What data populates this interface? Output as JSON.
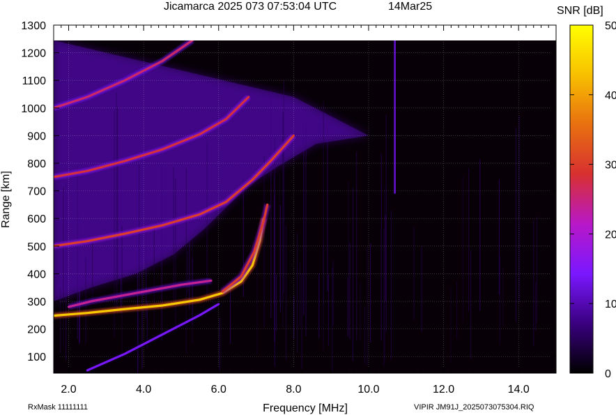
{
  "chart_data": {
    "type": "heatmap",
    "title": "Jicamarca 2025 073 07:53:04 UTC",
    "date_label": "14Mar25",
    "xlabel": "Frequency [MHz]",
    "ylabel": "Range [km]",
    "xlim": [
      1.6,
      15.0
    ],
    "ylim": [
      40,
      1300
    ],
    "data_range_top": 1245,
    "x_ticks": [
      "2.0",
      "4.0",
      "6.0",
      "8.0",
      "10.0",
      "12.0",
      "14.0"
    ],
    "x_tick_values": [
      2.0,
      4.0,
      6.0,
      8.0,
      10.0,
      12.0,
      14.0
    ],
    "y_ticks": [
      "100",
      "200",
      "300",
      "400",
      "500",
      "600",
      "700",
      "800",
      "900",
      "1000",
      "1100",
      "1200",
      "1300"
    ],
    "y_tick_values": [
      100,
      200,
      300,
      400,
      500,
      600,
      700,
      800,
      900,
      1000,
      1100,
      1200,
      1300
    ],
    "grid": true,
    "colorbar": {
      "label": "SNR [dB]",
      "range": [
        0,
        50
      ],
      "ticks": [
        "0",
        "10",
        "20",
        "30",
        "40",
        "50"
      ],
      "tick_values": [
        0,
        10,
        20,
        30,
        40,
        50
      ],
      "colors": [
        "#000000",
        "#3a0080",
        "#7a18ff",
        "#b818c8",
        "#d83030",
        "#e87010",
        "#f8c000",
        "#ffff00"
      ]
    },
    "background_snr": 1,
    "noise_cutoff": {
      "description_free": true,
      "points": [
        [
          1.6,
          1245
        ],
        [
          8.0,
          1040
        ],
        [
          10.0,
          900
        ],
        [
          8.6,
          870
        ],
        [
          7.6,
          790
        ],
        [
          6.8,
          720
        ],
        [
          6.2,
          640
        ],
        [
          5.6,
          560
        ],
        [
          4.8,
          470
        ],
        [
          3.8,
          400
        ],
        [
          2.6,
          350
        ],
        [
          1.6,
          300
        ]
      ]
    },
    "traces": [
      {
        "name": "",
        "snr": 44,
        "points": [
          [
            1.6,
            248
          ],
          [
            2.5,
            258
          ],
          [
            3.5,
            272
          ],
          [
            4.5,
            285
          ],
          [
            5.5,
            306
          ],
          [
            6.1,
            330
          ],
          [
            6.6,
            372
          ],
          [
            6.9,
            430
          ],
          [
            7.1,
            520
          ],
          [
            7.2,
            600
          ]
        ]
      },
      {
        "name": "",
        "snr": 30,
        "points": [
          [
            6.1,
            335
          ],
          [
            6.6,
            390
          ],
          [
            6.95,
            480
          ],
          [
            7.2,
            590
          ],
          [
            7.3,
            650
          ]
        ]
      },
      {
        "name": "",
        "snr": 30,
        "points": [
          [
            1.6,
            500
          ],
          [
            2.5,
            518
          ],
          [
            3.5,
            545
          ],
          [
            4.5,
            575
          ],
          [
            5.5,
            615
          ],
          [
            6.2,
            660
          ],
          [
            6.9,
            740
          ],
          [
            7.4,
            810
          ],
          [
            8.0,
            900
          ]
        ]
      },
      {
        "name": "",
        "snr": 28,
        "points": [
          [
            1.6,
            750
          ],
          [
            2.5,
            772
          ],
          [
            3.5,
            808
          ],
          [
            4.5,
            850
          ],
          [
            5.5,
            905
          ],
          [
            6.2,
            960
          ],
          [
            6.8,
            1040
          ]
        ]
      },
      {
        "name": "",
        "snr": 26,
        "points": [
          [
            1.6,
            1000
          ],
          [
            2.5,
            1040
          ],
          [
            3.5,
            1100
          ],
          [
            4.5,
            1170
          ],
          [
            5.3,
            1245
          ]
        ]
      },
      {
        "name": "",
        "snr": 24,
        "points": [
          [
            2.0,
            280
          ],
          [
            2.6,
            300
          ],
          [
            3.4,
            320
          ],
          [
            4.2,
            340
          ],
          [
            5.0,
            360
          ],
          [
            5.8,
            375
          ]
        ]
      },
      {
        "name": "",
        "snr": 14,
        "points": [
          [
            2.5,
            50
          ],
          [
            3.5,
            110
          ],
          [
            4.5,
            180
          ],
          [
            5.5,
            250
          ],
          [
            6.0,
            290
          ]
        ]
      }
    ],
    "vertical_features": [
      {
        "freq": 10.7,
        "range_min": 690,
        "range_max": 1245,
        "snr": 12
      }
    ]
  },
  "footer": {
    "rxmask": "RxMask 11111111",
    "filename": "VIPIR  JM91J_2025073075304.RIQ"
  }
}
